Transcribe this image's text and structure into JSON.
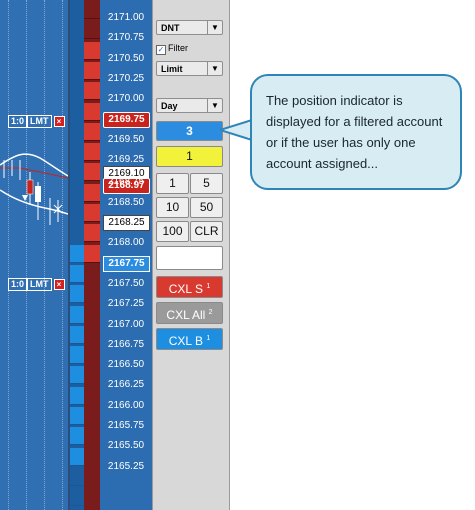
{
  "ladder_prices": [
    "2171.00",
    "2170.75",
    "2170.50",
    "2170.25",
    "2170.00",
    "2169.75",
    "2169.50",
    "2169.25",
    "2169.10",
    "2168.97",
    "2168.75",
    "2168.50",
    "2168.25",
    "2168.00",
    "2167.75",
    "2167.50",
    "2167.25",
    "2167.00",
    "2166.75",
    "2166.50",
    "2166.25",
    "2166.00",
    "2165.75",
    "2165.50",
    "2165.25"
  ],
  "order_tags": [
    {
      "qty": "1:0",
      "type": "LMT",
      "cancel": "×"
    },
    {
      "qty": "1:0",
      "type": "LMT",
      "cancel": "×"
    }
  ],
  "panel": {
    "duration": "DNT",
    "filter_label": "Filter",
    "filter_checked": "✓",
    "order_type": "Limit",
    "tif": "Day",
    "dropdown_arrow": "▼",
    "position": "3",
    "quantity": "1",
    "qty_buttons": [
      "1",
      "5",
      "10",
      "50",
      "100",
      "CLR"
    ],
    "price_field": "",
    "cxl_sell": "CXL S",
    "cxl_sell_count": "1",
    "cxl_all": "CXL All",
    "cxl_all_count": "2",
    "cxl_buy": "CXL B",
    "cxl_buy_count": "1"
  },
  "callout": {
    "text": "The position indicator is displayed for a filtered account or if the user has only one account assigned..."
  },
  "colors": {
    "sell": "#d93a30",
    "buy": "#1e8ee0",
    "position": "#2c8ce0",
    "quantity": "#f2f23a"
  }
}
